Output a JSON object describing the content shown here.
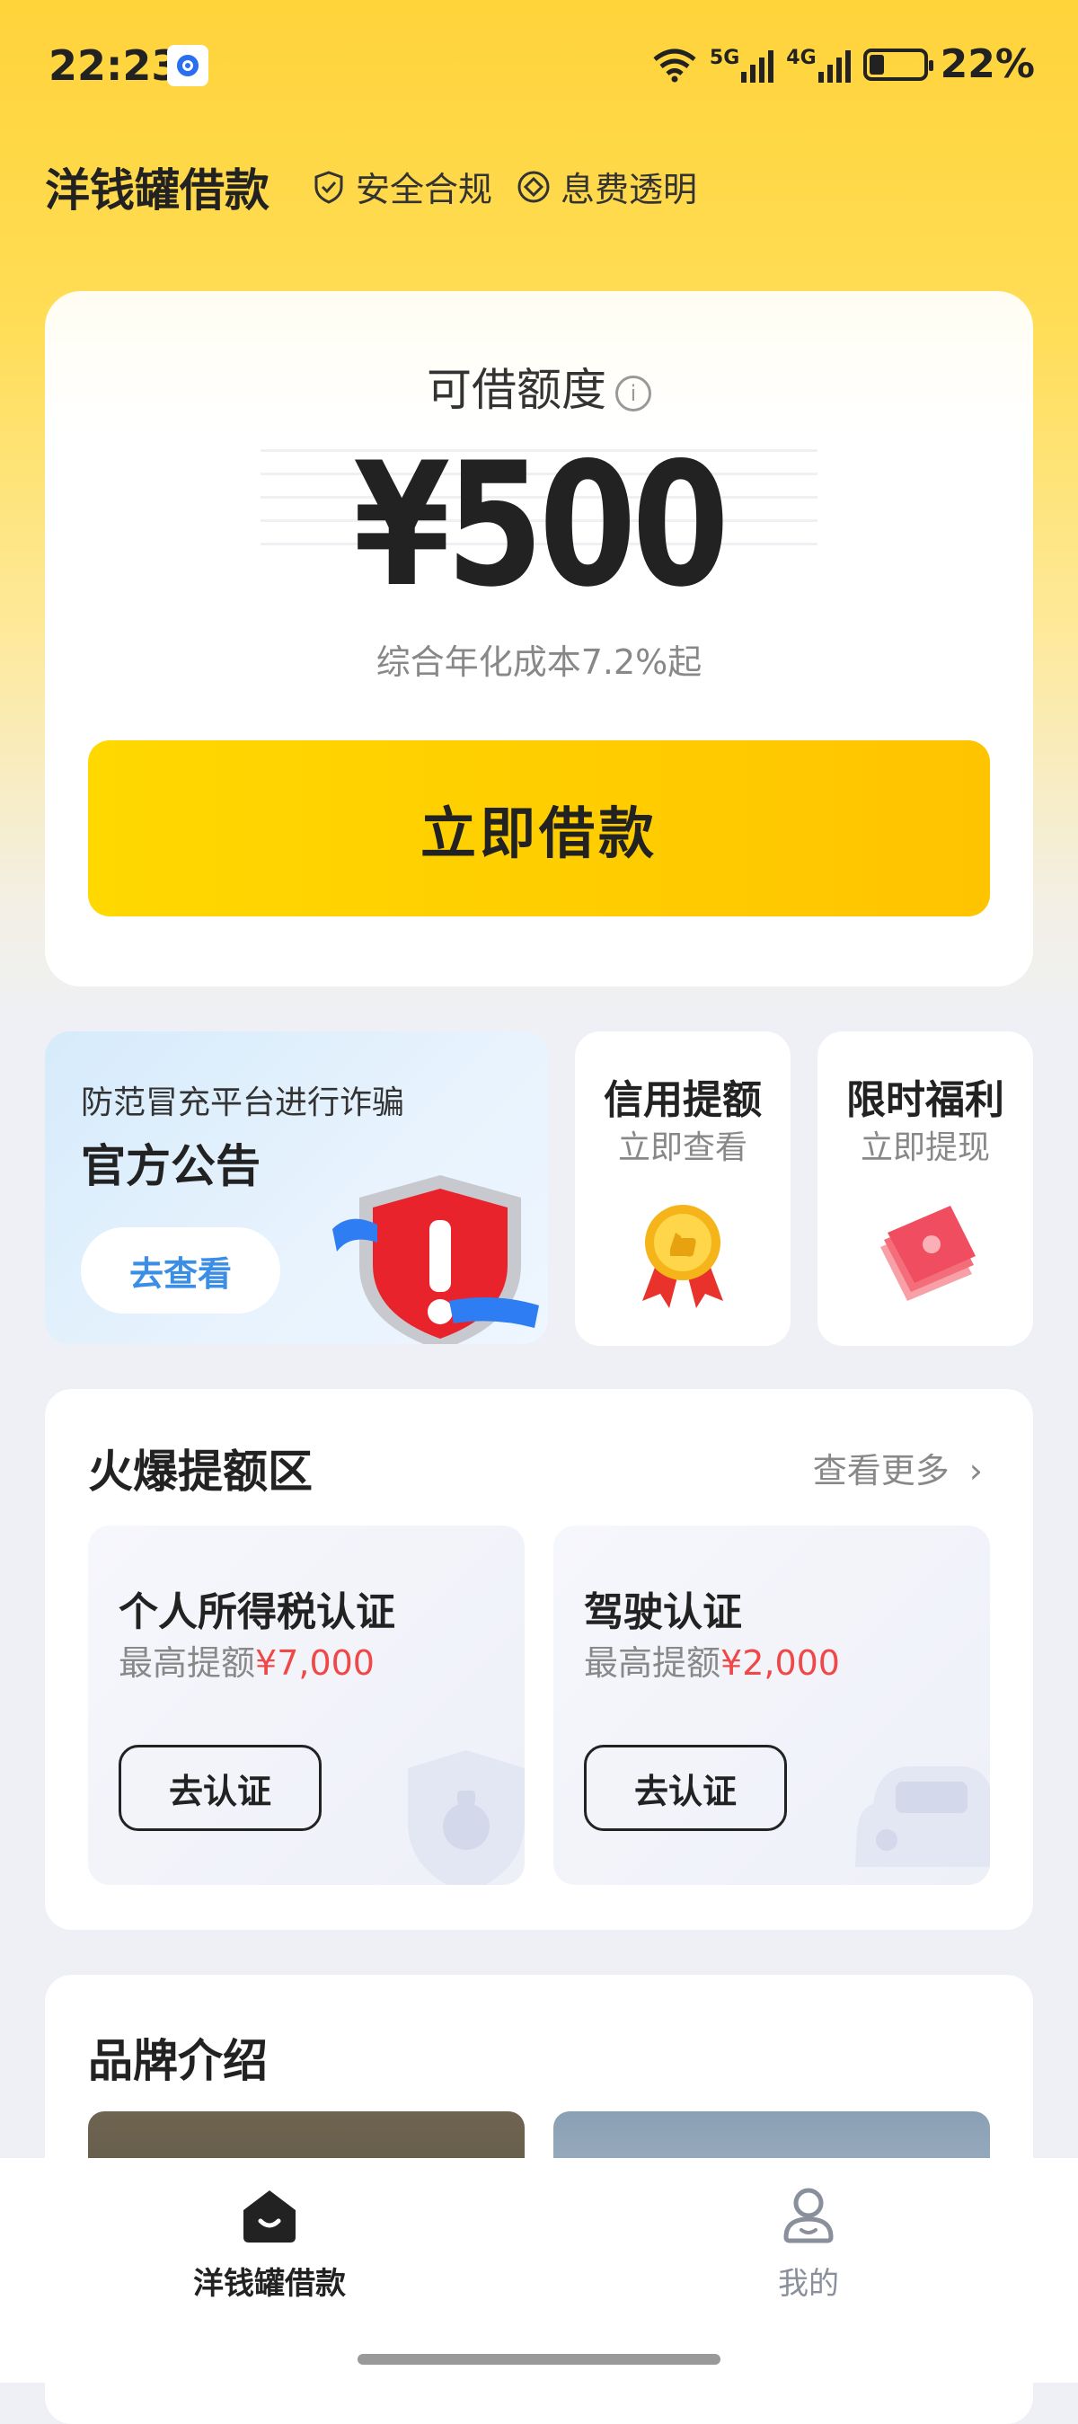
{
  "status_bar": {
    "time": "22:23",
    "network_1": "5G",
    "network_2": "4G",
    "battery": "22%"
  },
  "header": {
    "title": "洋钱罐借款",
    "badges": [
      {
        "label": "安全合规",
        "icon": "shield-check-icon"
      },
      {
        "label": "息费透明",
        "icon": "diamond-icon"
      }
    ]
  },
  "quota_card": {
    "label": "可借额度",
    "amount": "¥500",
    "rate_note": "综合年化成本7.2%起",
    "borrow_button": "立即借款",
    "accent_colors": [
      "#ffd800",
      "#ffc400"
    ]
  },
  "notice": {
    "subtitle": "防范冒充平台进行诈骗",
    "title": "官方公告",
    "button": "去查看"
  },
  "promos": [
    {
      "title": "信用提额",
      "subtitle": "立即查看",
      "icon": "medal-icon"
    },
    {
      "title": "限时福利",
      "subtitle": "立即提现",
      "icon": "cash-icon"
    }
  ],
  "hot_section": {
    "title": "火爆提额区",
    "more": "查看更多",
    "cards": [
      {
        "title": "个人所得税认证",
        "sub_prefix": "最高提额",
        "sub_amount": "¥7,000",
        "button": "去认证"
      },
      {
        "title": "驾驶认证",
        "sub_prefix": "最高提额",
        "sub_amount": "¥2,000",
        "button": "去认证"
      }
    ]
  },
  "brand": {
    "title": "品牌介绍"
  },
  "tabbar": {
    "items": [
      {
        "label": "洋钱罐借款",
        "active": true
      },
      {
        "label": "我的",
        "active": false
      }
    ]
  }
}
